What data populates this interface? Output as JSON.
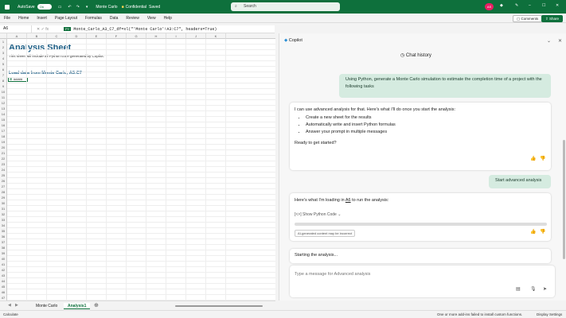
{
  "titlebar": {
    "autosave_label": "AutoSave",
    "autosave_state": "On",
    "file_name": "Monte Carlo",
    "sensitivity": "Confidential",
    "saved_state": "Saved",
    "search_placeholder": "Search",
    "avatar_initials": "AS"
  },
  "ribbon": {
    "tabs": [
      "File",
      "Home",
      "Insert",
      "Page Layout",
      "Formulas",
      "Data",
      "Review",
      "View",
      "Help"
    ],
    "comments_label": "Comments",
    "share_label": "Share"
  },
  "formula_bar": {
    "name_box": "A6",
    "python_badge": "PY",
    "formula": "Monte_Carlo_A3_C7_df=xl(\"'Monte Carlo'!A3:C7\", headers=True)"
  },
  "grid": {
    "columns": [
      "A",
      "B",
      "C",
      "D",
      "E",
      "F",
      "G",
      "H",
      "I",
      "J",
      "K"
    ],
    "rows": [
      "1",
      "2",
      "3",
      "4",
      "5",
      "6",
      "7",
      "8",
      "9",
      "10",
      "11",
      "12",
      "13",
      "14",
      "15",
      "16",
      "17",
      "18",
      "19",
      "20",
      "21",
      "22",
      "23",
      "24",
      "25",
      "26",
      "27",
      "28",
      "29",
      "30",
      "31",
      "32",
      "33",
      "34",
      "35",
      "36",
      "37",
      "38",
      "39",
      "40",
      "41",
      "42",
      "43",
      "44",
      "45",
      "46",
      "47"
    ],
    "sheet_title": "Analysis Sheet",
    "sheet_subtitle": "This sheet will include all Python code generated by Copilot.",
    "load_title": "Load data from Monte Carlo, A3:C7",
    "active_cell_value": "#####"
  },
  "sheet_tabs": {
    "tabs": [
      "Monte Carlo",
      "Analysis1"
    ],
    "active": "Analysis1"
  },
  "statusbar": {
    "left": "Calculate",
    "addins": "One or more add-ins failed to install custom functions.",
    "display": "Display Settings"
  },
  "copilot": {
    "title": "Copilot",
    "chat_history": "Chat history",
    "user_msg_1": "Using Python, generate a Monte Carlo simulation to estimate the completion time of a project with the following tasks",
    "assistant_intro": "I can use advanced analysis for that. Here's what I'll do once you start the analysis:",
    "assistant_steps": [
      "Create a new sheet for the results",
      "Automatically write and insert Python formulas",
      "Answer your prompt in multiple messages"
    ],
    "assistant_question": "Ready to get started?",
    "user_msg_2": "Start advanced analysis",
    "loading_prefix": "Here's what I'm loading in",
    "loading_cell": "A6",
    "loading_suffix": "to run the analysis:",
    "show_code": "Show Python Code",
    "disclaimer": "AI-generated content may be incorrect",
    "starting": "Starting the analysis...",
    "input_placeholder": "Type a message for Advanced analysis"
  }
}
